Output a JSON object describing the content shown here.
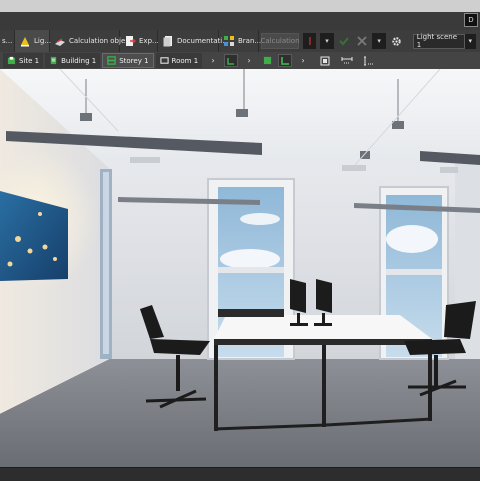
{
  "window": {
    "corner_icon": "D"
  },
  "tabs": [
    {
      "label": "s...",
      "icon": "doc-icon"
    },
    {
      "label": "Lig...",
      "icon": "light-icon",
      "active": true
    },
    {
      "label": "Calculation obje...",
      "icon": "calculation-object-icon"
    },
    {
      "label": "Exp...",
      "icon": "export-icon"
    },
    {
      "label": "Documentati...",
      "icon": "documentation-icon"
    },
    {
      "label": "Bran...",
      "icon": "branch-icon"
    }
  ],
  "toolbar": {
    "calculation_label": "Calculation",
    "light_scene": "Light scene 1",
    "dropdown_arrow": "▾"
  },
  "breadcrumb": [
    {
      "label": "Site 1",
      "icon": "site-icon"
    },
    {
      "label": "Building 1",
      "icon": "building-icon"
    },
    {
      "label": "Storey 1",
      "icon": "storey-icon",
      "highlighted": true
    },
    {
      "label": "Room 1",
      "icon": "room-icon"
    }
  ],
  "colors": {
    "toolbar_bg": "#3d3d3d",
    "accent_green": "#3fae49",
    "accent_yellow": "#e8c21a",
    "accent_red": "#d23a3a"
  }
}
